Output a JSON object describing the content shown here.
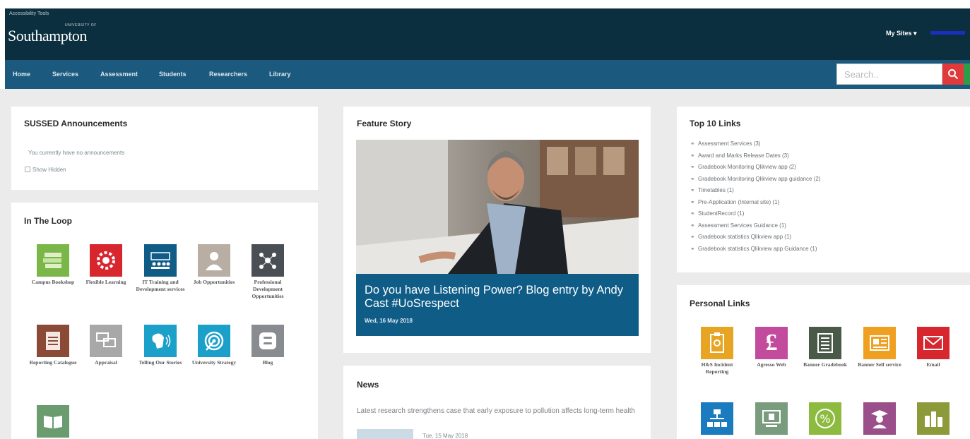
{
  "header": {
    "accessibility_tools": "Accessibility Tools",
    "logo_small": "UNIVERSITY OF",
    "logo": "Southampton",
    "my_sites": "My Sites ▾"
  },
  "nav": {
    "items": [
      "Home",
      "Services",
      "Assessment",
      "Students",
      "Researchers",
      "Library"
    ]
  },
  "search": {
    "placeholder": "Search.."
  },
  "announcements": {
    "title": "SUSSED Announcements",
    "empty_text": "You currently have no announcements",
    "show_hidden": "Show Hidden"
  },
  "loop": {
    "title": "In The Loop",
    "tiles": [
      {
        "label": "Campus Bookshop",
        "icon": "books-icon",
        "color": "#7ab648"
      },
      {
        "label": "Flexible Learning",
        "icon": "flex-gear-icon",
        "color": "#d8262f"
      },
      {
        "label": "IT Training and Development services",
        "icon": "training-icon",
        "color": "#0f5c87"
      },
      {
        "label": "Job Opportunities",
        "icon": "people-icon",
        "color": "#b9aea3"
      },
      {
        "label": "Professional Development Opportunities",
        "icon": "network-icon",
        "color": "#4a4f55"
      },
      {
        "label": "Reporting Catalogue",
        "icon": "catalogue-icon",
        "color": "#8a4a36"
      },
      {
        "label": "Appraisal",
        "icon": "chat-icon",
        "color": "#a8a8a8"
      },
      {
        "label": "Telling Our Stories",
        "icon": "speaker-icon",
        "color": "#1aa0c9"
      },
      {
        "label": "University Strategy",
        "icon": "target-icon",
        "color": "#1aa0c9"
      },
      {
        "label": "Blog",
        "icon": "blog-icon",
        "color": "#888c90"
      },
      {
        "label": "",
        "icon": "book-icon",
        "color": "#6b9c70"
      }
    ]
  },
  "feature": {
    "title": "Feature Story",
    "headline": "Do you have Listening Power? Blog entry by Andy Cast #UoSrespect",
    "date": "Wed, 16 May 2018"
  },
  "news": {
    "title": "News",
    "headline": "Latest research strengthens case that early exposure to pollution affects long-term health",
    "date": "Tue, 15 May 2018"
  },
  "top_links": {
    "title": "Top 10 Links",
    "items": [
      "Assessment Services (3)",
      "Award and Marks Release Dates (3)",
      "Gradebook Monitoring Qlikview app (2)",
      "Gradebook Monitoring Qlikview app guidance (2)",
      "Timetables (1)",
      "Pre-Application (Internal site) (1)",
      "StudentRecord (1)",
      "Assessment Services Guidance (1)",
      "Gradebook statistics Qlikview app (1)",
      "Gradebook statistics Qlikview app Guidance (1)"
    ]
  },
  "personal_links": {
    "title": "Personal Links",
    "tiles": [
      {
        "label": "H&S Incident Reporting",
        "icon": "clipboard-icon",
        "color": "#e8a523"
      },
      {
        "label": "Agresso Web",
        "icon": "pound-icon",
        "color": "#c34b9e"
      },
      {
        "label": "Banner Gradebook",
        "icon": "notebook-icon",
        "color": "#4a5a48"
      },
      {
        "label": "Banner Self service",
        "icon": "form-icon",
        "color": "#f0a020"
      },
      {
        "label": "Email",
        "icon": "envelope-icon",
        "color": "#d8262f"
      },
      {
        "label": "",
        "icon": "org-chart-icon",
        "color": "#1a7bbf"
      },
      {
        "label": "",
        "icon": "monitor-icon",
        "color": "#7a9c7e"
      },
      {
        "label": "",
        "icon": "percent-icon",
        "color": "#8dbb3f"
      },
      {
        "label": "",
        "icon": "graduate-icon",
        "color": "#9a4e8a"
      },
      {
        "label": "",
        "icon": "building-icon",
        "color": "#8d9a3a"
      }
    ]
  }
}
